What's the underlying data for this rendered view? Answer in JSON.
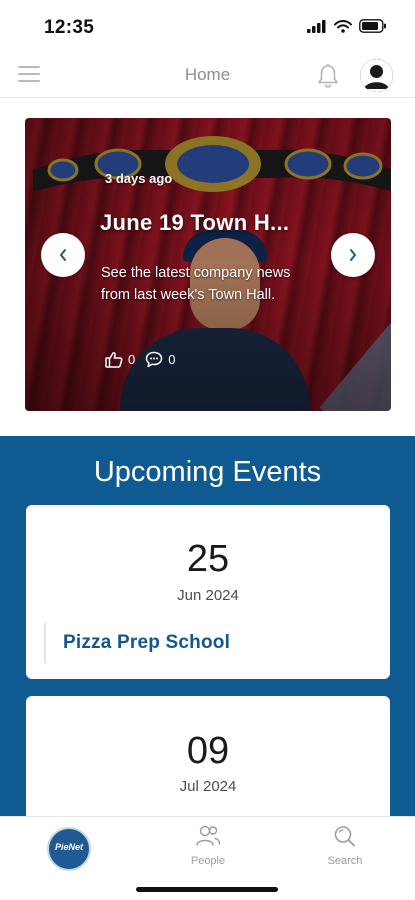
{
  "status_bar": {
    "time": "12:35"
  },
  "header": {
    "title": "Home"
  },
  "hero": {
    "date": "3 days ago",
    "title": "June 19 Town H...",
    "description": "See the latest company news from last week's Town Hall.",
    "likes": "0",
    "comments": "0"
  },
  "events": {
    "title": "Upcoming Events",
    "items": [
      {
        "day": "25",
        "month": "Jun 2024",
        "name": "Pizza Prep School"
      },
      {
        "day": "09",
        "month": "Jul 2024"
      }
    ]
  },
  "bottom_nav": {
    "logo_text": "PieNet",
    "items": [
      {
        "label": "People"
      },
      {
        "label": "Search"
      }
    ]
  },
  "colors": {
    "brand_blue": "#105a92",
    "event_title_blue": "#15568f"
  }
}
